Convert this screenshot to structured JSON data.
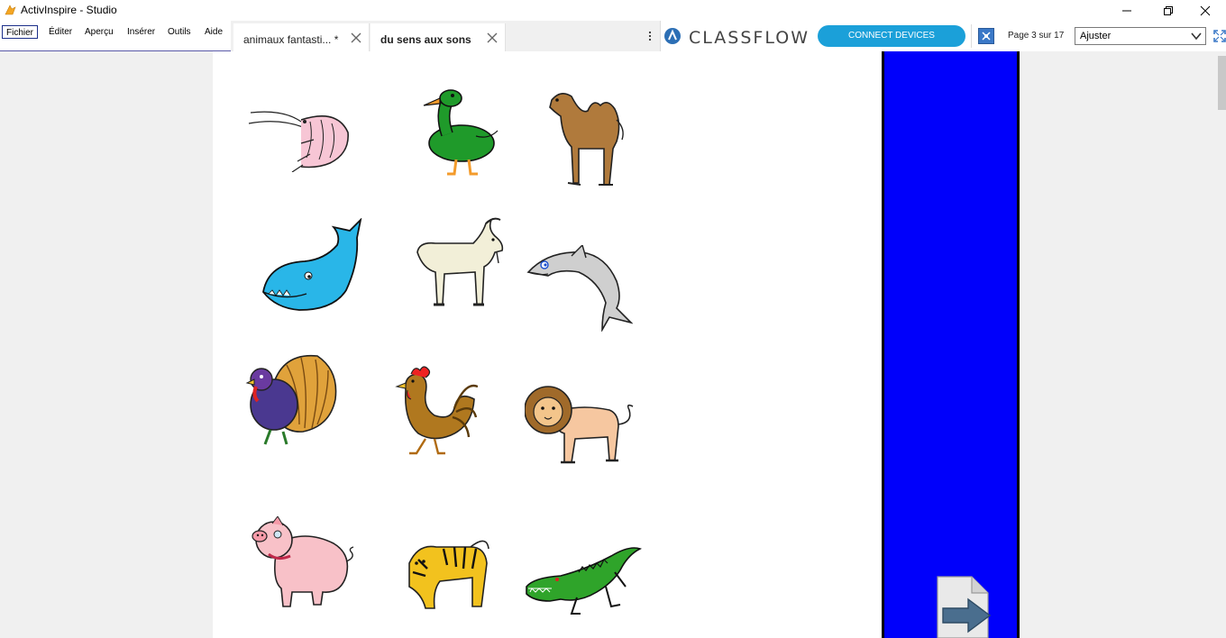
{
  "titlebar": {
    "title": "ActivInspire - Studio"
  },
  "menu": {
    "items": [
      {
        "label": "Fichier",
        "active": true
      },
      {
        "label": "Éditer"
      },
      {
        "label": "Aperçu"
      },
      {
        "label": "Insérer"
      },
      {
        "label": "Outils"
      },
      {
        "label": "Aide"
      }
    ]
  },
  "tabs": [
    {
      "label": "animaux fantasti... *",
      "selected": false
    },
    {
      "label": "du sens aux sons",
      "selected": true
    }
  ],
  "classflow": {
    "brand": "CLASSFLOW",
    "connect_label": "CONNECT DEVICES"
  },
  "pager": {
    "page_label": "Page 3 sur 17",
    "zoom_value": "Ajuster"
  },
  "colors": {
    "blue_bar": "#0000fb",
    "connect_button": "#1ba0d9"
  },
  "animals": [
    {
      "icon": "shrimp-icon"
    },
    {
      "icon": "duck-icon"
    },
    {
      "icon": "camel-icon"
    },
    {
      "icon": "whale-icon"
    },
    {
      "icon": "goat-icon"
    },
    {
      "icon": "dolphin-icon"
    },
    {
      "icon": "turkey-icon"
    },
    {
      "icon": "rooster-icon"
    },
    {
      "icon": "lion-icon"
    },
    {
      "icon": "pig-icon"
    },
    {
      "icon": "tiger-icon"
    },
    {
      "icon": "crocodile-icon"
    }
  ]
}
